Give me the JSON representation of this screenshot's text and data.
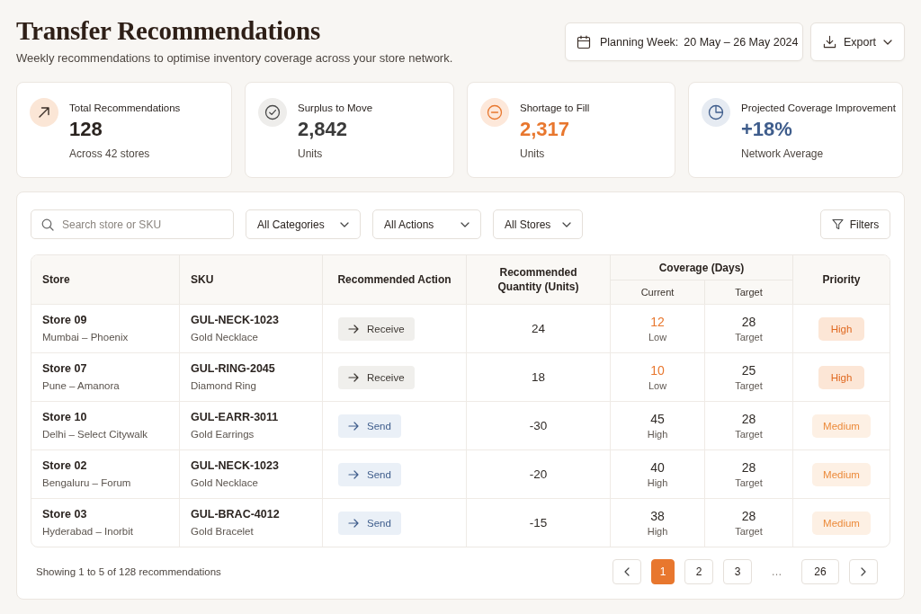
{
  "header": {
    "title": "Transfer Recommendations",
    "subtitle": "Weekly recommendations to optimise inventory coverage across your store network.",
    "planning_week": {
      "label": "Planning Week:",
      "value": "20 May – 26 May 2024"
    },
    "export": "Export"
  },
  "stats": [
    {
      "kind": "trend",
      "label": "Total Recommendations",
      "value": "128",
      "caption": "Across 42 stores",
      "color": "#2b2420"
    },
    {
      "kind": "check",
      "label": "Surplus to Move",
      "value": "2,842",
      "caption": "Units",
      "color": "#3a3a3a"
    },
    {
      "kind": "minus",
      "label": "Shortage to Fill",
      "value": "2,317",
      "caption": "Units",
      "color": "#e8772e"
    },
    {
      "kind": "pie",
      "label": "Projected Coverage Improvement",
      "value": "+18%",
      "caption": "Network Average",
      "color": "#3f5d8c"
    }
  ],
  "filters": {
    "search": {
      "placeholder": "Search store or SKU"
    },
    "dropdowns": [
      "All Categories",
      "All Actions",
      "All Stores"
    ],
    "filters_button": "Filters"
  },
  "table": {
    "columns": [
      {
        "label": "Store"
      },
      {
        "label": "SKU"
      },
      {
        "label": "Recommended Action"
      },
      {
        "label": "Recommended Quantity (Units)"
      },
      {
        "label": "Coverage (Days)",
        "children": [
          {
            "label": "Current"
          },
          {
            "label": "Target"
          }
        ]
      },
      {
        "label": "Priority"
      }
    ],
    "rows": [
      {
        "store": "Store 09",
        "location": "Mumbai – Phoenix",
        "sku": "GUL-NECK-1023",
        "product": "Gold Necklace",
        "action": {
          "kind": "receive",
          "label": "Receive"
        },
        "quantity": "24",
        "current": {
          "kind": "low",
          "value": "12",
          "label": "Low"
        },
        "target": {
          "value": "28",
          "label": "Target"
        },
        "priority": {
          "kind": "high",
          "label": "High"
        }
      },
      {
        "store": "Store 07",
        "location": "Pune – Amanora",
        "sku": "GUL-RING-2045",
        "product": "Diamond Ring",
        "action": {
          "kind": "receive",
          "label": "Receive"
        },
        "quantity": "18",
        "current": {
          "kind": "low",
          "value": "10",
          "label": "Low"
        },
        "target": {
          "value": "25",
          "label": "Target"
        },
        "priority": {
          "kind": "high",
          "label": "High"
        }
      },
      {
        "store": "Store 10",
        "location": "Delhi – Select Citywalk",
        "sku": "GUL-EARR-3011",
        "product": "Gold Earrings",
        "action": {
          "kind": "send",
          "label": "Send"
        },
        "quantity": "-30",
        "current": {
          "kind": "high",
          "value": "45",
          "label": "High"
        },
        "target": {
          "value": "28",
          "label": "Target"
        },
        "priority": {
          "kind": "medium",
          "label": "Medium"
        }
      },
      {
        "store": "Store 02",
        "location": "Bengaluru – Forum",
        "sku": "GUL-NECK-1023",
        "product": "Gold Necklace",
        "action": {
          "kind": "send",
          "label": "Send"
        },
        "quantity": "-20",
        "current": {
          "kind": "high",
          "value": "40",
          "label": "High"
        },
        "target": {
          "value": "28",
          "label": "Target"
        },
        "priority": {
          "kind": "medium",
          "label": "Medium"
        }
      },
      {
        "store": "Store 03",
        "location": "Hyderabad – Inorbit",
        "sku": "GUL-BRAC-4012",
        "product": "Gold Bracelet",
        "action": {
          "kind": "send",
          "label": "Send"
        },
        "quantity": "-15",
        "current": {
          "kind": "high",
          "value": "38",
          "label": "High"
        },
        "target": {
          "value": "28",
          "label": "Target"
        },
        "priority": {
          "kind": "medium",
          "label": "Medium"
        }
      }
    ]
  },
  "pagination": {
    "summary": "Showing 1 to 5 of 128 recommendations",
    "pages": [
      {
        "kind": "page",
        "label": "1",
        "selected": true
      },
      {
        "kind": "page",
        "label": "2",
        "selected": false
      },
      {
        "kind": "page",
        "label": "3",
        "selected": false
      },
      {
        "kind": "ellipsis",
        "label": "…"
      },
      {
        "kind": "page",
        "label": "26",
        "selected": false
      }
    ]
  }
}
